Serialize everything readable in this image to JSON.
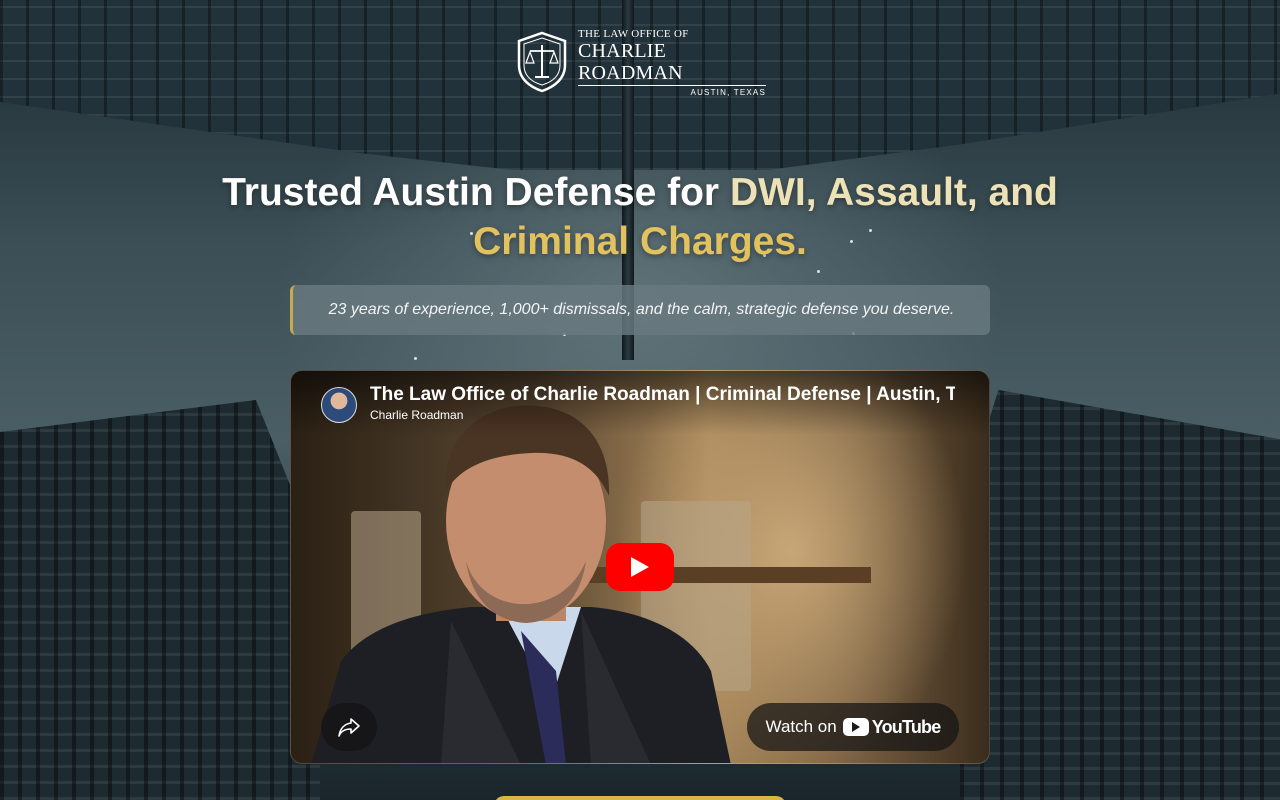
{
  "logo": {
    "line1": "THE LAW OFFICE OF",
    "line2": "CHARLIE ROADMAN",
    "line3": "AUSTIN, TEXAS",
    "icon": "scales-of-justice-shield-icon"
  },
  "hero": {
    "headline_part1": "Trusted Austin Defense for ",
    "headline_part2": "DWI, Assault, and",
    "headline_part3": "Criminal Charges.",
    "subheadline": "23 years of experience, 1,000+ dismissals, and the calm, strategic defense you deserve."
  },
  "video": {
    "title": "The Law Office of Charlie Roadman | Criminal Defense | Austin, Texas",
    "channel": "Charlie Roadman",
    "watch_on": "Watch on",
    "youtube_word": "YouTube",
    "icons": [
      "play-icon",
      "share-icon",
      "youtube-icon"
    ]
  },
  "colors": {
    "gold": "#e2c25f",
    "cream": "#ede1b6",
    "youtube_red": "#ff0000",
    "accent_border": "#c9a94b"
  }
}
